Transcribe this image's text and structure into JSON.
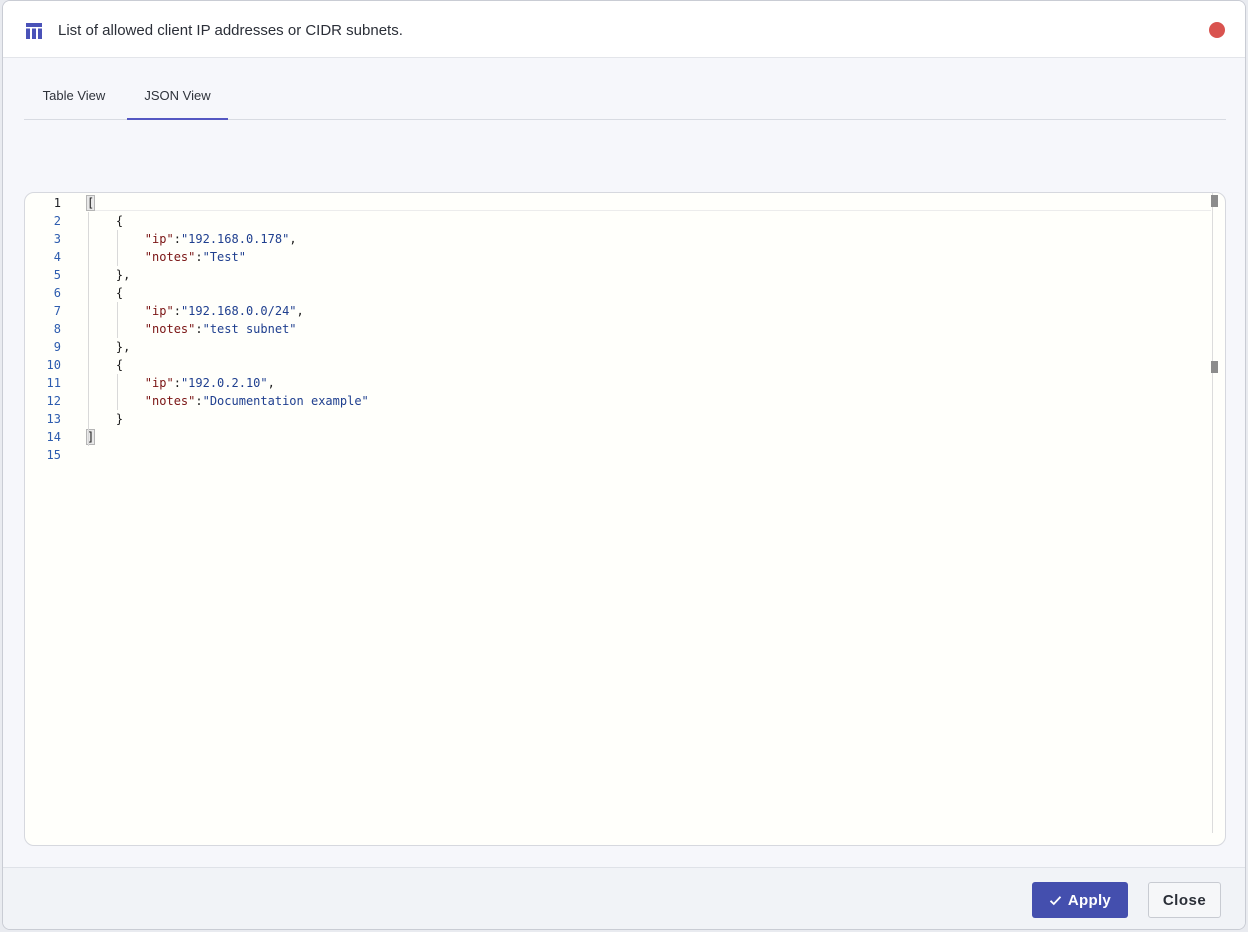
{
  "dialog": {
    "title": "List of allowed client IP addresses or CIDR subnets.",
    "header_icon": "table-icon",
    "close_icon": "close-dot-icon",
    "accent_color": "#444fae",
    "close_dot_color": "#d9534f"
  },
  "tabs": [
    {
      "label": "Table View",
      "active": false
    },
    {
      "label": "JSON View",
      "active": true
    }
  ],
  "editor": {
    "line_numbers": [
      "1",
      "2",
      "3",
      "4",
      "5",
      "6",
      "7",
      "8",
      "9",
      "10",
      "11",
      "12",
      "13",
      "14",
      "15"
    ],
    "active_line": "1",
    "lines": [
      {
        "indent": "",
        "text": "["
      },
      {
        "indent": "    ",
        "text": "{"
      },
      {
        "indent": "        ",
        "key": "\"ip\"",
        "sep": ":",
        "value": "\"192.168.0.178\"",
        "trail": ","
      },
      {
        "indent": "        ",
        "key": "\"notes\"",
        "sep": ":",
        "value": "\"Test\"",
        "trail": ""
      },
      {
        "indent": "    ",
        "text": "},"
      },
      {
        "indent": "    ",
        "text": "{"
      },
      {
        "indent": "        ",
        "key": "\"ip\"",
        "sep": ":",
        "value": "\"192.168.0.0/24\"",
        "trail": ","
      },
      {
        "indent": "        ",
        "key": "\"notes\"",
        "sep": ":",
        "value": "\"test subnet\"",
        "trail": ""
      },
      {
        "indent": "    ",
        "text": "},"
      },
      {
        "indent": "    ",
        "text": "{"
      },
      {
        "indent": "        ",
        "key": "\"ip\"",
        "sep": ":",
        "value": "\"192.0.2.10\"",
        "trail": ","
      },
      {
        "indent": "        ",
        "key": "\"notes\"",
        "sep": ":",
        "value": "\"Documentation example\"",
        "trail": ""
      },
      {
        "indent": "    ",
        "text": "}"
      },
      {
        "indent": "",
        "text": "]"
      },
      {
        "indent": "",
        "text": ""
      }
    ]
  },
  "footer": {
    "apply_label": "Apply",
    "apply_icon": "check-icon",
    "close_label": "Close"
  }
}
